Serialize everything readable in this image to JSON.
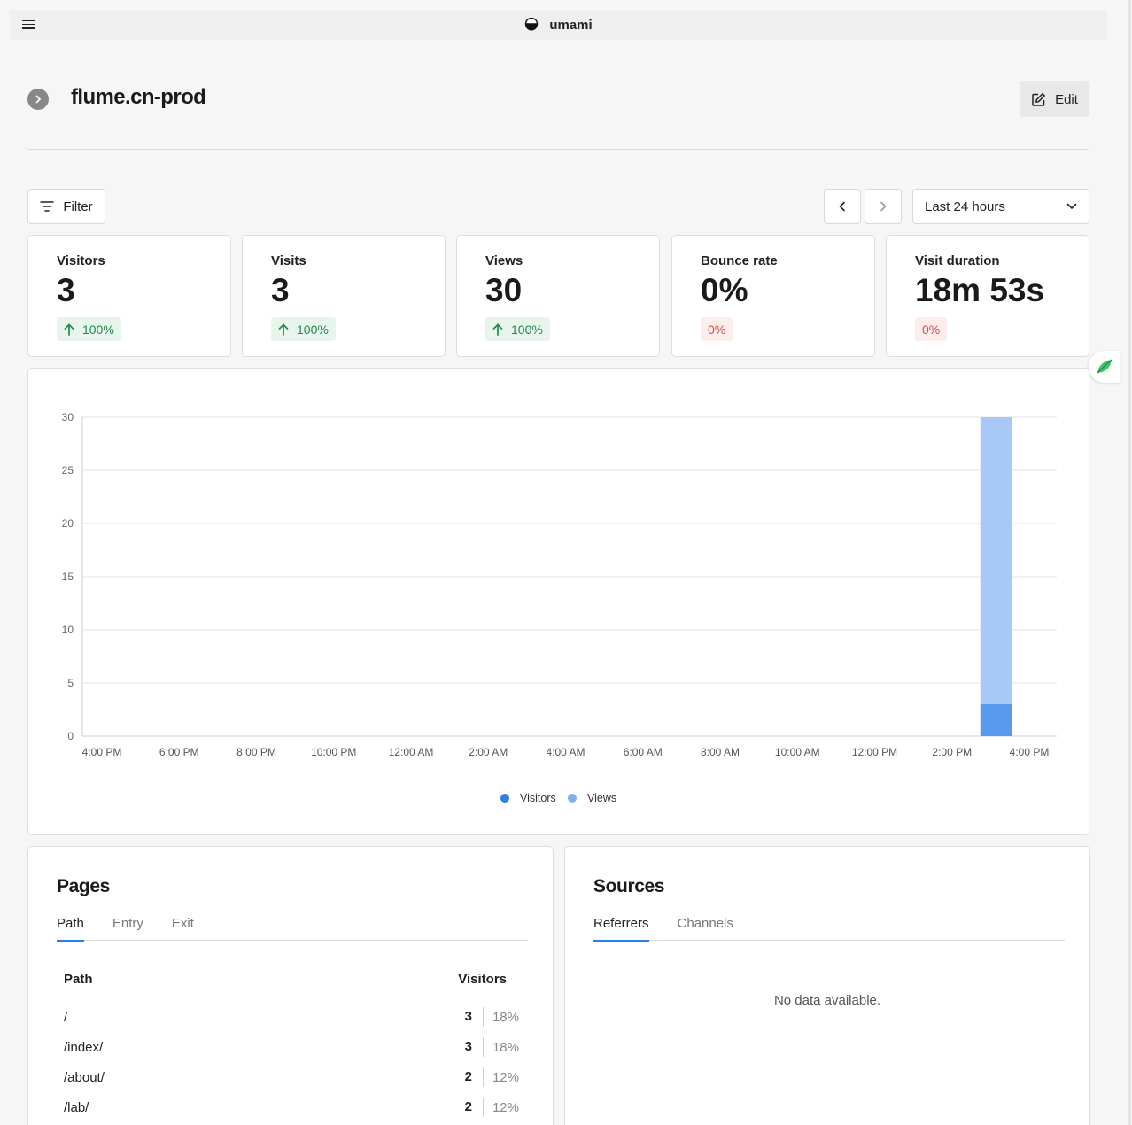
{
  "app": {
    "brand": "umami"
  },
  "header": {
    "site_name": "flume.cn-prod",
    "edit_label": "Edit"
  },
  "toolbar": {
    "filter_label": "Filter",
    "date_range": "Last 24 hours"
  },
  "metrics": [
    {
      "label": "Visitors",
      "value": "3",
      "change": "100%",
      "trend": "up"
    },
    {
      "label": "Visits",
      "value": "3",
      "change": "100%",
      "trend": "up"
    },
    {
      "label": "Views",
      "value": "30",
      "change": "100%",
      "trend": "up"
    },
    {
      "label": "Bounce rate",
      "value": "0%",
      "change": "0%",
      "trend": "neutral"
    },
    {
      "label": "Visit duration",
      "value": "18m 53s",
      "change": "0%",
      "trend": "neutral"
    }
  ],
  "chart_data": {
    "type": "bar",
    "stacked": true,
    "categories": [
      "4:00 PM",
      "6:00 PM",
      "8:00 PM",
      "10:00 PM",
      "12:00 AM",
      "2:00 AM",
      "4:00 AM",
      "6:00 AM",
      "8:00 AM",
      "10:00 AM",
      "12:00 PM",
      "2:00 PM",
      "4:00 PM"
    ],
    "bar_at_hour_index": 23,
    "hour_count": 25,
    "series": [
      {
        "name": "Visitors",
        "color": "#5799ed",
        "value": 3
      },
      {
        "name": "Views",
        "color": "#a8c8f5",
        "value": 30
      }
    ],
    "yticks": [
      0,
      5,
      10,
      15,
      20,
      25,
      30
    ],
    "ylim": [
      0,
      30
    ],
    "grid": true,
    "legend": "bottom"
  },
  "pages": {
    "title": "Pages",
    "tabs": [
      "Path",
      "Entry",
      "Exit"
    ],
    "active_tab": 0,
    "columns": [
      "Path",
      "Visitors"
    ],
    "rows": [
      {
        "path": "/",
        "visitors": "3",
        "pct": "18%"
      },
      {
        "path": "/index/",
        "visitors": "3",
        "pct": "18%"
      },
      {
        "path": "/about/",
        "visitors": "2",
        "pct": "12%"
      },
      {
        "path": "/lab/",
        "visitors": "2",
        "pct": "12%"
      }
    ]
  },
  "sources": {
    "title": "Sources",
    "tabs": [
      "Referrers",
      "Channels"
    ],
    "active_tab": 0,
    "empty_message": "No data available."
  }
}
